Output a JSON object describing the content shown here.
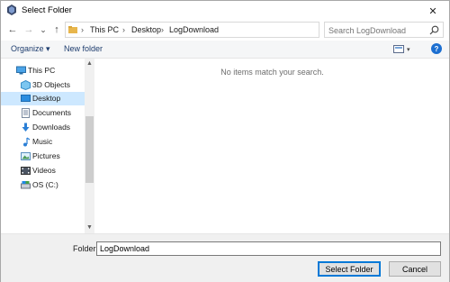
{
  "window": {
    "title": "Select Folder",
    "close_glyph": "✕"
  },
  "nav": {
    "back_glyph": "←",
    "forward_glyph": "→",
    "recent_glyph": "⌄",
    "up_glyph": "↑",
    "breadcrumbs": [
      "This PC",
      "Desktop",
      "LogDownload"
    ],
    "separator": "›",
    "dropdown_glyph": "⌄",
    "refresh_glyph": "↻"
  },
  "search": {
    "placeholder": "Search LogDownload",
    "value": ""
  },
  "toolbar": {
    "organize_label": "Organize ▾",
    "new_folder_label": "New folder",
    "view_dropdown_glyph": "▾",
    "help_label": "?"
  },
  "sidebar": {
    "items": [
      {
        "label": "This PC",
        "icon": "computer-icon",
        "selected": false
      },
      {
        "label": "3D Objects",
        "icon": "3d-objects-icon",
        "selected": false
      },
      {
        "label": "Desktop",
        "icon": "desktop-icon",
        "selected": true
      },
      {
        "label": "Documents",
        "icon": "documents-icon",
        "selected": false
      },
      {
        "label": "Downloads",
        "icon": "downloads-icon",
        "selected": false
      },
      {
        "label": "Music",
        "icon": "music-icon",
        "selected": false
      },
      {
        "label": "Pictures",
        "icon": "pictures-icon",
        "selected": false
      },
      {
        "label": "Videos",
        "icon": "videos-icon",
        "selected": false
      },
      {
        "label": "OS (C:)",
        "icon": "drive-icon",
        "selected": false
      }
    ],
    "scroll_up_glyph": "▲",
    "scroll_down_glyph": "▼"
  },
  "content": {
    "empty_message": "No items match your search."
  },
  "footer": {
    "folder_label": "Folder:",
    "folder_value": "LogDownload",
    "select_button": "Select Folder",
    "cancel_button": "Cancel"
  },
  "colors": {
    "accent": "#0078d7",
    "selection": "#cde8ff",
    "link": "#1e3d6e"
  }
}
